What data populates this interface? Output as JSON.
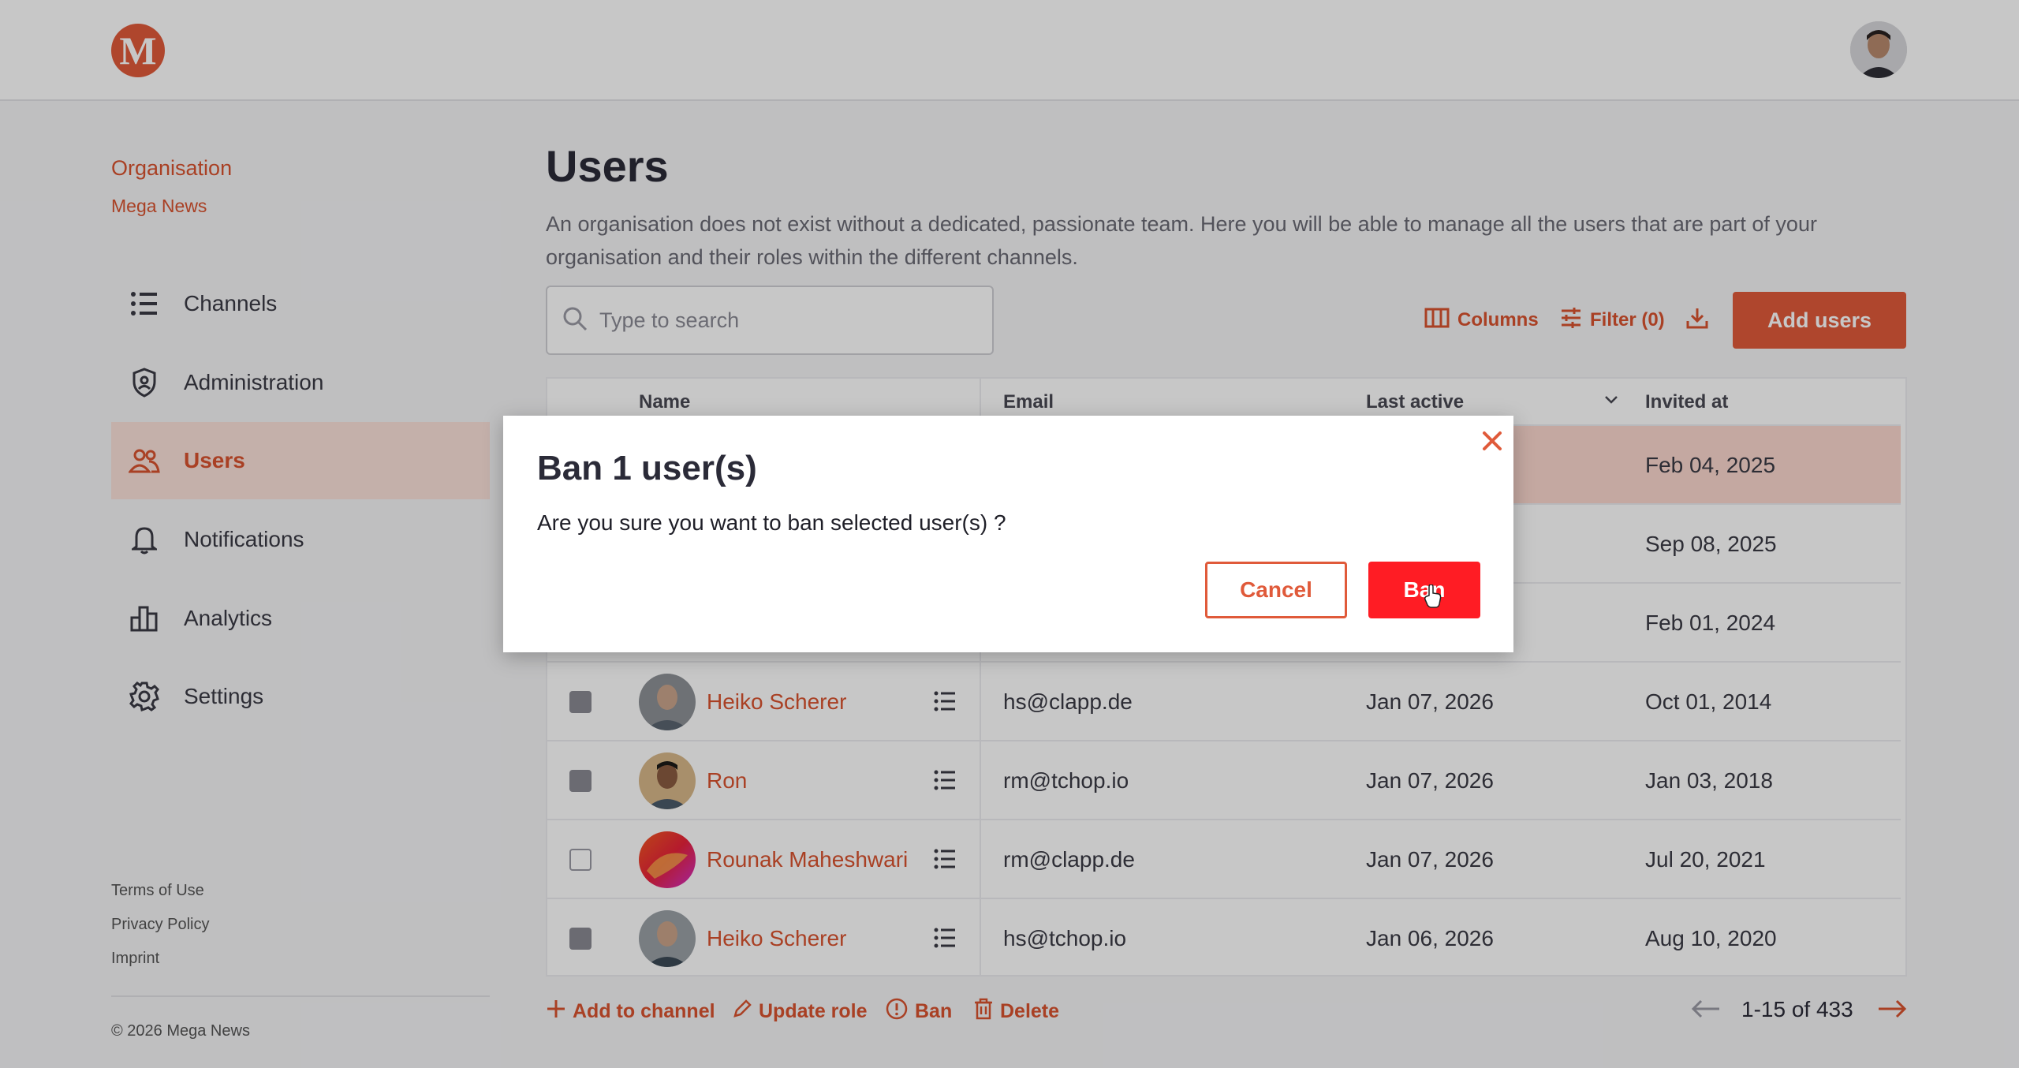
{
  "header": {
    "logo_letter": "M",
    "avatar_icon": "user-avatar"
  },
  "sidebar": {
    "org_label": "Organisation",
    "org_name": "Mega News",
    "items": [
      {
        "label": "Channels",
        "icon": "list-icon"
      },
      {
        "label": "Administration",
        "icon": "shield-icon"
      },
      {
        "label": "Users",
        "icon": "users-icon",
        "active": true
      },
      {
        "label": "Notifications",
        "icon": "bell-icon"
      },
      {
        "label": "Analytics",
        "icon": "bar-chart-icon"
      },
      {
        "label": "Settings",
        "icon": "gear-icon"
      }
    ],
    "footer_links": [
      "Terms of Use",
      "Privacy Policy",
      "Imprint"
    ],
    "copyright": "© 2026 Mega News"
  },
  "main": {
    "title": "Users",
    "description": "An organisation does not exist without a dedicated, passionate team. Here you will be able to manage all the users that are part of your organisation and their roles within the different channels.",
    "search_placeholder": "Type to search",
    "toolbar": {
      "columns_label": "Columns",
      "filter_label": "Filter (0)",
      "add_users_label": "Add users"
    },
    "table": {
      "headers": {
        "name": "Name",
        "email": "Email",
        "last_active": "Last active",
        "invited_at": "Invited at"
      },
      "rows": [
        {
          "name": "",
          "email": "",
          "last_active": "",
          "invited_at": "Feb 04, 2025",
          "checked": true,
          "selected": true
        },
        {
          "name": "",
          "email": "",
          "last_active": "",
          "invited_at": "Sep 08, 2025",
          "checked": false
        },
        {
          "name": "",
          "email": "",
          "last_active": "",
          "invited_at": "Feb 01, 2024",
          "checked": false
        },
        {
          "name": "Heiko Scherer",
          "email": "hs@clapp.de",
          "last_active": "Jan 07, 2026",
          "invited_at": "Oct 01, 2014",
          "checked": true
        },
        {
          "name": "Ron",
          "email": "rm@tchop.io",
          "last_active": "Jan 07, 2026",
          "invited_at": "Jan 03, 2018",
          "checked": true
        },
        {
          "name": "Rounak Maheshwari",
          "email": "rm@clapp.de",
          "last_active": "Jan 07, 2026",
          "invited_at": "Jul 20, 2021",
          "checked": false
        },
        {
          "name": "Heiko Scherer",
          "email": "hs@tchop.io",
          "last_active": "Jan 06, 2026",
          "invited_at": "Aug 10, 2020",
          "checked": true
        }
      ]
    },
    "bulk_actions": {
      "add_to_channel": "Add to channel",
      "update_role": "Update role",
      "ban": "Ban",
      "delete": "Delete"
    },
    "pagination": {
      "range": "1-15 of 433"
    }
  },
  "dialog": {
    "title": "Ban 1 user(s)",
    "body": "Are you sure you want to ban selected user(s) ?",
    "cancel_label": "Cancel",
    "confirm_label": "Ban"
  },
  "colors": {
    "accent": "#e05a3a",
    "danger": "#ff1c24",
    "selected_row": "#fbd8cf"
  }
}
